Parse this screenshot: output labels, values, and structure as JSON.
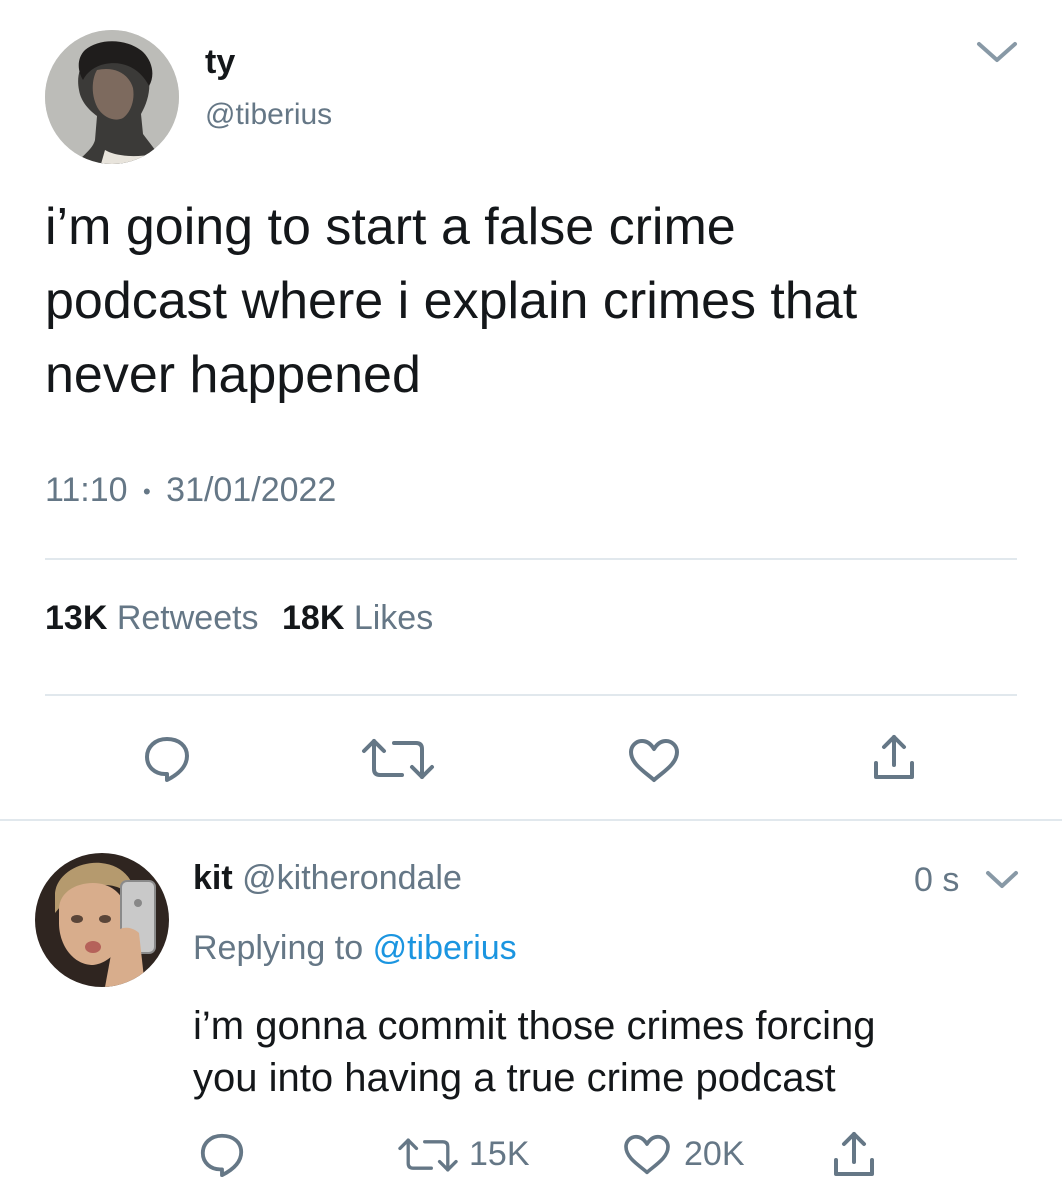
{
  "main_tweet": {
    "author_name": "ty",
    "author_handle": "@tiberius",
    "text_lines": [
      "i’m going to start a false crime",
      "podcast where i explain crimes that",
      "never happened"
    ],
    "time": "11:10",
    "separator": "•",
    "date": "31/01/2022",
    "retweet_count": "13K",
    "retweet_label": "Retweets",
    "like_count": "18K",
    "like_label": "Likes"
  },
  "reply": {
    "author_name": "kit",
    "author_handle": "@kitherondale",
    "timestamp": "0 s",
    "replying_prefix": "Replying to",
    "replying_handle": "@tiberius",
    "text_lines": [
      "i’m gonna commit those crimes forcing",
      "you into having a true crime podcast"
    ],
    "retweet_count": "15K",
    "like_count": "20K"
  },
  "icons": {
    "caret": "chevron-down-icon",
    "reply": "reply-icon",
    "retweet": "retweet-icon",
    "like": "heart-icon",
    "share": "share-icon"
  },
  "colors": {
    "text": "#14171a",
    "secondary": "#657786",
    "link": "#1b95e0",
    "divider": "#e1e8ed",
    "icon": "#657786"
  }
}
